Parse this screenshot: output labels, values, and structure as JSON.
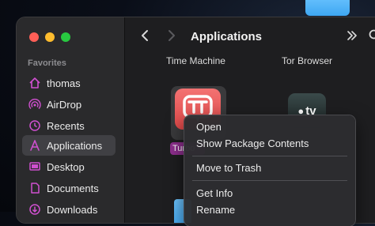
{
  "sidebar": {
    "heading": "Favorites",
    "items": [
      {
        "label": "thomas",
        "icon": "home-icon"
      },
      {
        "label": "AirDrop",
        "icon": "airdrop-icon"
      },
      {
        "label": "Recents",
        "icon": "clock-icon"
      },
      {
        "label": "Applications",
        "icon": "applications-icon",
        "selected": true
      },
      {
        "label": "Desktop",
        "icon": "desktop-icon"
      },
      {
        "label": "Documents",
        "icon": "document-icon"
      },
      {
        "label": "Downloads",
        "icon": "download-icon"
      }
    ]
  },
  "toolbar": {
    "title": "Applications",
    "back_icon": "chevron-left-icon",
    "forward_icon": "chevron-right-icon",
    "more_icon": "double-chevron-right-icon",
    "search_icon": "search-icon"
  },
  "content": {
    "apps_top": [
      "Time Machine",
      "Tor Browser"
    ],
    "selected_app_name": "Turbo",
    "tv_label": "tv"
  },
  "context_menu": {
    "items": [
      "Open",
      "Show Package Contents",
      "Move to Trash",
      "Get Info",
      "Rename"
    ]
  },
  "colors": {
    "accent_icon": "#d050d0",
    "window_bg": "#1e1e20",
    "sidebar_bg": "#2a2a2c",
    "selection_badge": "#8e2f8e"
  }
}
